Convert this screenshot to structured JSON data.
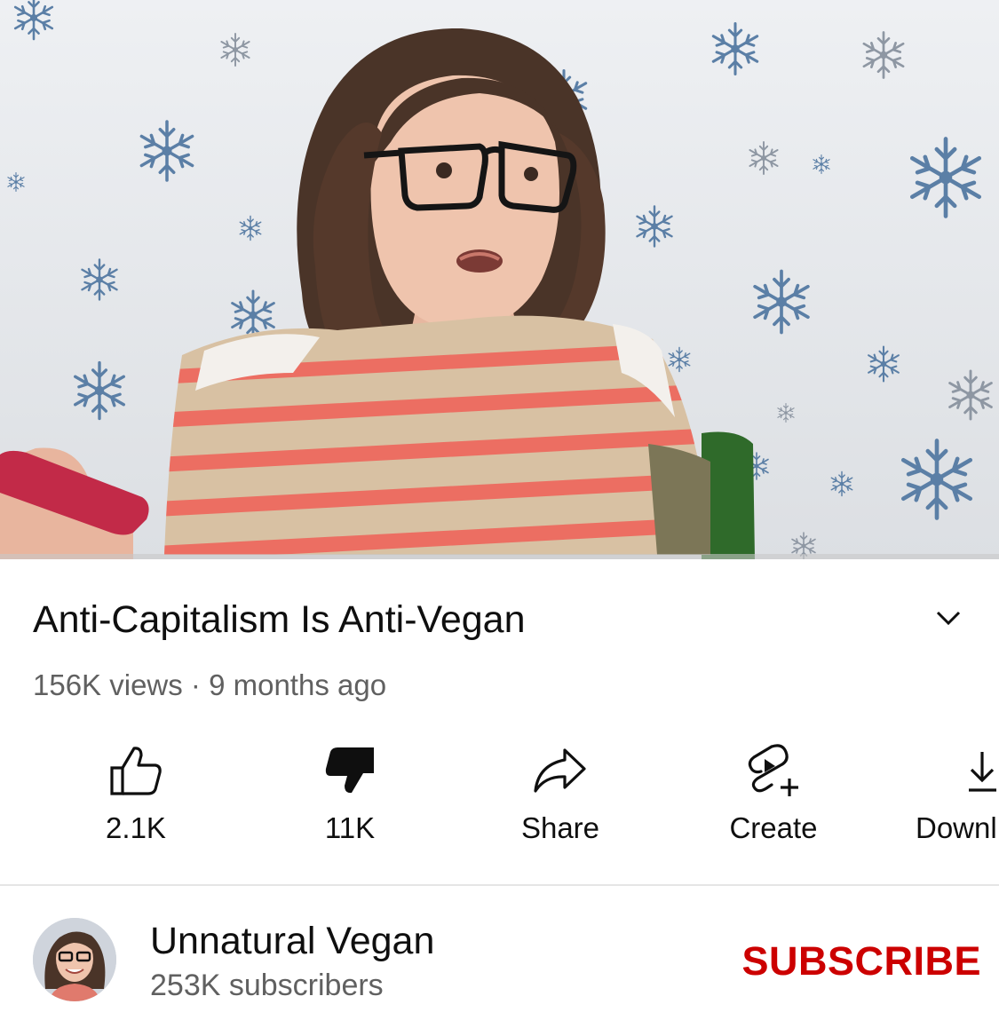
{
  "video": {
    "title": "Anti-Capitalism Is Anti-Vegan",
    "meta": "156K views · 9 months ago"
  },
  "actions": [
    {
      "label": "2.1K",
      "icon": "thumbs-up-icon"
    },
    {
      "label": "11K",
      "icon": "thumbs-down-icon"
    },
    {
      "label": "Share",
      "icon": "share-icon"
    },
    {
      "label": "Create",
      "icon": "create-icon"
    },
    {
      "label": "Downl",
      "icon": "download-icon"
    }
  ],
  "channel": {
    "name": "Unnatural Vegan",
    "subscribers": "253K subscribers",
    "subscribe_label": "SUBSCRIBE"
  },
  "colors": {
    "subscribe": "#cc0000",
    "secondary_text": "#606060",
    "snowflake": "#5b7fa6"
  }
}
